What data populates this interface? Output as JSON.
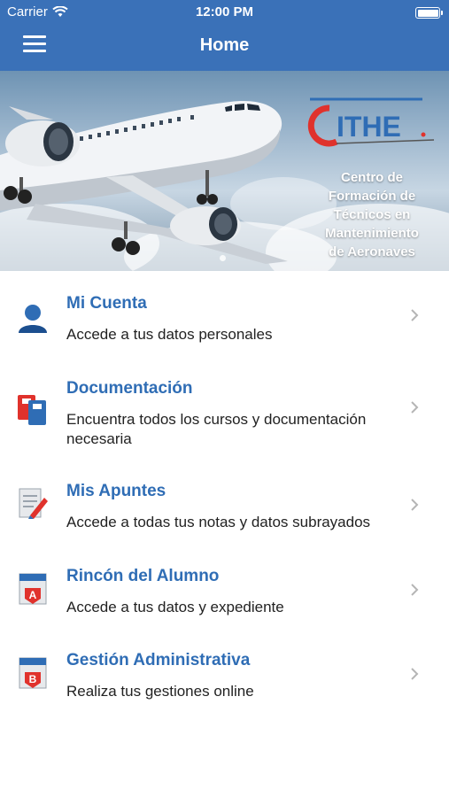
{
  "status": {
    "carrier": "Carrier",
    "time": "12:00 PM"
  },
  "nav": {
    "title": "Home"
  },
  "banner": {
    "logo_text": "CITHE.",
    "subtitle_lines": [
      "Centro de",
      "Formación de",
      "Técnicos en",
      "Mantenimiento",
      "de Aeronaves"
    ]
  },
  "menu": [
    {
      "title": "Mi Cuenta",
      "desc": "Accede a tus datos personales",
      "icon": "user-icon"
    },
    {
      "title": "Documentación",
      "desc": "Encuentra todos los cursos y documentación necesaria",
      "icon": "folders-icon"
    },
    {
      "title": "Mis Apuntes",
      "desc": "Accede a todas tus notas y datos subrayados",
      "icon": "notes-icon"
    },
    {
      "title": "Rincón del Alumno",
      "desc": "Accede a tus datos y expediente",
      "icon": "badge-a-icon"
    },
    {
      "title": "Gestión Administrativa",
      "desc": "Realiza tus gestiones online",
      "icon": "badge-b-icon"
    }
  ],
  "colors": {
    "accent": "#2f6db5",
    "bar": "#3a71b8"
  }
}
